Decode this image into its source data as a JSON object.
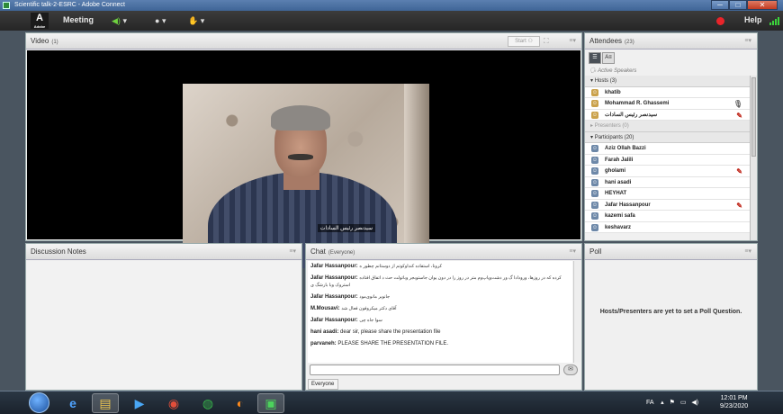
{
  "window": {
    "title": "Scientific talk-2-ESRC - Adobe Connect",
    "minimize": "─",
    "maximize": "□",
    "close": "✕"
  },
  "menubar": {
    "logo_text": "Adobe",
    "meeting": "Meeting",
    "help": "Help",
    "mic_symbol": "◀)",
    "cam_symbol": "●",
    "share_symbol": "✋",
    "caret": "▾"
  },
  "video_pod": {
    "title": "Video",
    "count": "(1)",
    "start_label": "Start",
    "menu": "≡▾",
    "participant_name": "سیدنصر رئیس السادات"
  },
  "attendees_pod": {
    "title": "Attendees",
    "count": "(23)",
    "menu": "≡▾",
    "active_speakers": "Active Speakers",
    "hosts_group": "Hosts (3)",
    "hosts": [
      "khatib",
      "Mohammad R. Ghassemi",
      "سیدنصر رئیس السادات"
    ],
    "presenters_group": "Presenters (0)",
    "participants_group": "Participants (20)",
    "participants": [
      "Aziz Ollah Bazzi",
      "Farah Jalili",
      "gholami",
      "hani asadi",
      "HEYHAT",
      "Jafar Hassanpour",
      "kazemi safa",
      "keshavarz"
    ]
  },
  "notes_pod": {
    "title": "Discussion Notes",
    "menu": "≡▾"
  },
  "chat_pod": {
    "title": "Chat",
    "scope": "(Everyone)",
    "menu": "≡▾",
    "messages": [
      {
        "sender": "Jafar Hassanpour:",
        "text": "کرونا، استفاده کنداوکوتم از دوستانم چطور ه"
      },
      {
        "sender": "Jafar Hassanpour:",
        "text": "کرده که در روزها، ورودادا گ ور دشت‌وپاپ‌وم متر در روز را در دون یوان جاستوبجر وباتولت‌ حث د اتفاق افتاده استروک وبا بارشگ ی"
      },
      {
        "sender": "Jafar Hassanpour:",
        "text": "جانوبر مانوی‌مود"
      },
      {
        "sender": "M.Mousavi:",
        "text": "آقای دکتر میکروفون فعال شد"
      },
      {
        "sender": "Jafar Hassanpour:",
        "text": "سوا جاه چی"
      },
      {
        "sender": "hani asadi:",
        "text": "dear sir, please share the presentation file"
      },
      {
        "sender": "parvaneh:",
        "text": "PLEASE SHARE THE PRESENTATION FILE."
      }
    ],
    "input_placeholder": "",
    "tab_label": "Everyone"
  },
  "poll_pod": {
    "title": "Poll",
    "menu": "≡▾",
    "message": "Hosts/Presenters are yet to set a Poll Question."
  },
  "taskbar": {
    "language": "FA",
    "time": "12:01 PM",
    "date": "9/23/2020"
  }
}
